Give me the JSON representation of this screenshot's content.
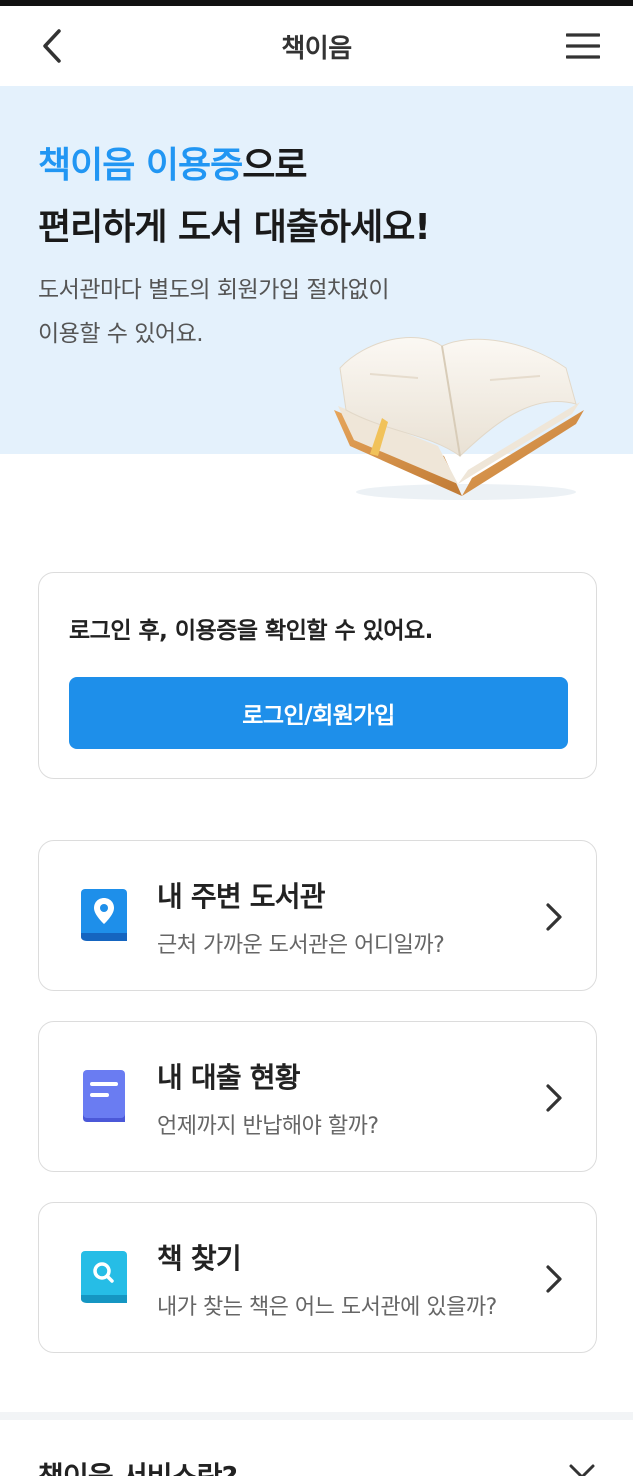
{
  "header": {
    "title": "책이음"
  },
  "hero": {
    "title_accent": "책이음 이용증",
    "title_rest": "으로",
    "title_line2": "편리하게 도서 대출하세요!",
    "desc_line1": "도서관마다 별도의 회원가입 절차없이",
    "desc_line2": "이용할 수 있어요."
  },
  "login_card": {
    "message": "로그인 후, 이용증을 확인할 수 있어요.",
    "button_label": "로그인/회원가입"
  },
  "menu": [
    {
      "title": "내 주변 도서관",
      "subtitle": "근처 가까운 도서관은 어디일까?",
      "icon": "location-pin-icon",
      "color": "#1e8fea"
    },
    {
      "title": "내 대출 현황",
      "subtitle": "언제까지 반납해야 할까?",
      "icon": "document-icon",
      "color": "#5b6cf0"
    },
    {
      "title": "책 찾기",
      "subtitle": "내가 찾는 책은 어느 도서관에 있을까?",
      "icon": "search-icon",
      "color": "#22b6e0"
    }
  ],
  "service_section": {
    "title": "책이음 서비스란?"
  },
  "colors": {
    "accent": "#2196f3",
    "button": "#1e8fea",
    "hero_bg": "#e4f1fc"
  }
}
